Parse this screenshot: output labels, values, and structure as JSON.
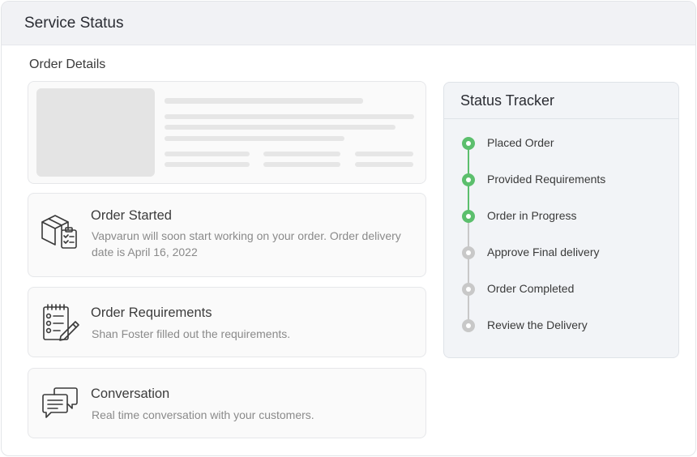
{
  "header": {
    "title": "Service Status"
  },
  "section": {
    "title": "Order Details"
  },
  "cards": [
    {
      "icon": "package-checklist-icon",
      "title": "Order Started",
      "description": "Vapvarun will soon start working on your order. Order delivery date is April 16, 2022"
    },
    {
      "icon": "requirements-clipboard-icon",
      "title": "Order Requirements",
      "description": "Shan Foster filled out the requirements."
    },
    {
      "icon": "chat-bubbles-icon",
      "title": "Conversation",
      "description": "Real time conversation with your customers."
    }
  ],
  "tracker": {
    "title": "Status Tracker",
    "steps": [
      {
        "label": "Placed Order",
        "status": "complete"
      },
      {
        "label": "Provided Requirements",
        "status": "complete"
      },
      {
        "label": "Order in Progress",
        "status": "complete"
      },
      {
        "label": "Approve Final delivery",
        "status": "pending"
      },
      {
        "label": "Order Completed",
        "status": "pending"
      },
      {
        "label": "Review the Delivery",
        "status": "pending"
      }
    ],
    "colors": {
      "complete": "#5cbf6d",
      "pending": "#c8c8c8"
    }
  }
}
